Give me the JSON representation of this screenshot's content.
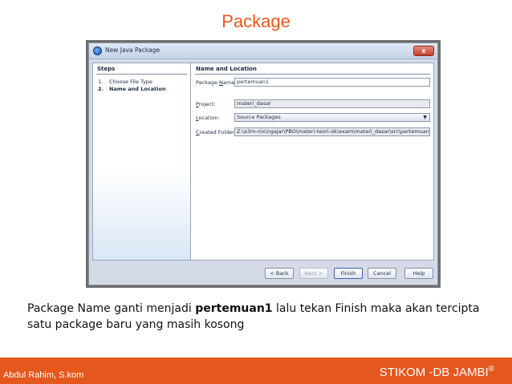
{
  "slide": {
    "title": "Package",
    "caption_pre": "Package Name ganti menjadi ",
    "caption_bold": "pertemuan1",
    "caption_post": "  lalu tekan Finish maka akan tercipta satu package baru yang masih kosong",
    "footer_author": "Abdul Rahim, S.kom",
    "footer_org": "STIKOM -DB JAMBI",
    "footer_org_mark": "®"
  },
  "dialog": {
    "title": "New Java Package",
    "close_label": "x",
    "steps": {
      "heading": "Steps",
      "items": [
        {
          "num": "1.",
          "label": "Choose File Type"
        },
        {
          "num": "2.",
          "label": "Name and Location"
        }
      ]
    },
    "main": {
      "heading": "Name and Location",
      "package_name": {
        "label_pre": "Package ",
        "label_u": "N",
        "label_post": "ame:",
        "value": "pertemuan1"
      },
      "project": {
        "label_pre": "",
        "label_u": "P",
        "label_post": "roject:",
        "value": "materi_dasar"
      },
      "location": {
        "label_pre": "",
        "label_u": "L",
        "label_post": "ocation:",
        "value": "Source Packages",
        "arrow": "▼"
      },
      "created_folder": {
        "label_pre": "",
        "label_u": "C",
        "label_post": "reated Folder:",
        "value": "Z:\\a3m-nix\\ngajar\\PBO\\materi-teori-ok\\exam\\materi_dasar\\src\\pertemuan1"
      }
    },
    "buttons": {
      "back": "< Back",
      "next": "Next >",
      "finish": "Finish",
      "cancel": "Cancel",
      "help": "Help"
    }
  },
  "colors": {
    "accent": "#e4571d",
    "title": "#e8591a"
  }
}
